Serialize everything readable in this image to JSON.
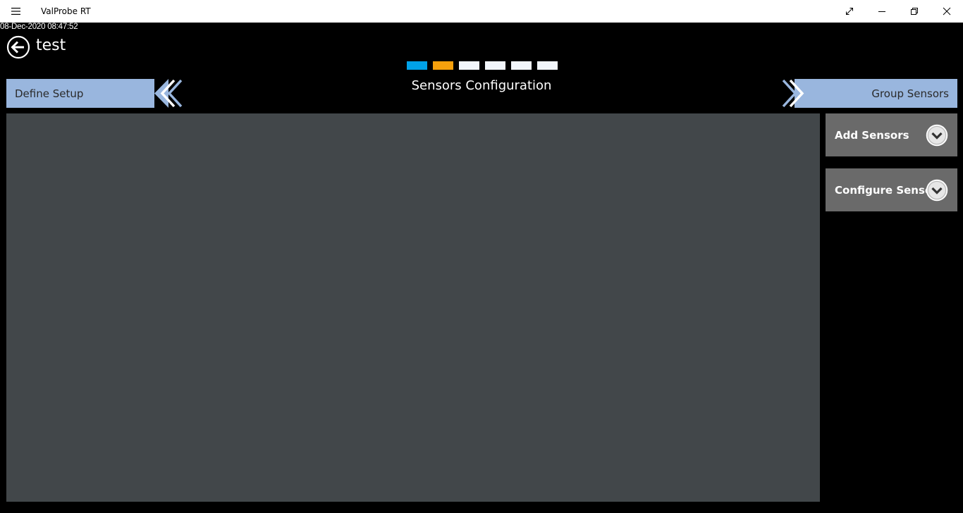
{
  "window": {
    "title": "ValProbe RT",
    "icons": {
      "menu": "hamburger-menu-icon",
      "fullscreen": "expand-icon",
      "minimize": "minimize-icon",
      "restore": "restore-icon",
      "close": "close-icon"
    }
  },
  "header": {
    "timestamp": "08-Dec-2020 08:47:52",
    "back_icon": "back-arrow-icon",
    "title": "test"
  },
  "wizard": {
    "steps": [
      {
        "color": "#00a2e8"
      },
      {
        "color": "#f7a10c"
      },
      {
        "color": "#f2f6fb"
      },
      {
        "color": "#f2f6fb"
      },
      {
        "color": "#f2f6fb"
      },
      {
        "color": "#f2f6fb"
      }
    ],
    "prev_label": "Define Setup",
    "next_label": "Group Sensors",
    "current_title": "Sensors Configuration"
  },
  "side_panels": [
    {
      "label": "Add Sensors",
      "icon": "chevron-down-circle-icon"
    },
    {
      "label": "Configure Sensors",
      "icon": "chevron-down-circle-icon"
    }
  ],
  "colors": {
    "accent_blue": "#00a2e8",
    "accent_orange": "#f7a10c",
    "nav_bar": "#99b6de",
    "content_panel": "#42474a",
    "accordion_bg": "#6a6a6a"
  }
}
